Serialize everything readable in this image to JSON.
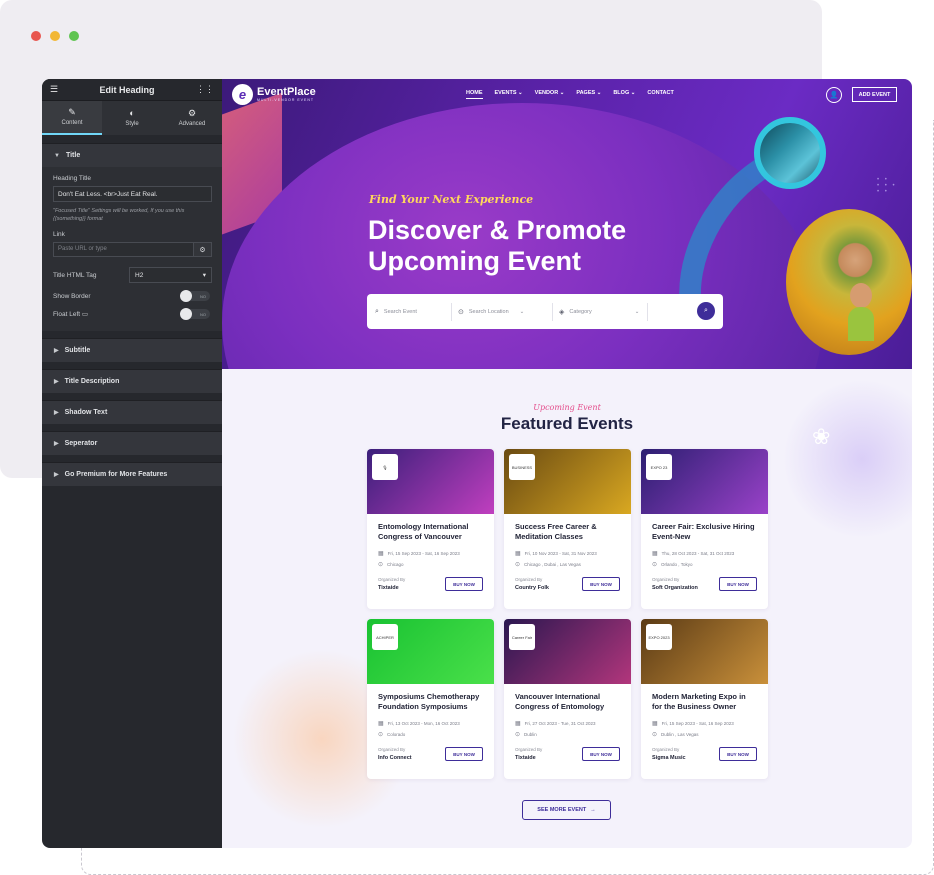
{
  "window": {
    "dots": [
      "#e8564f",
      "#f2b735",
      "#5fc451"
    ]
  },
  "editor": {
    "title": "Edit Heading",
    "menu_icon": "hamburger-icon",
    "grid_icon": "grid-icon",
    "tabs": [
      {
        "label": "Content",
        "icon": "pencil-icon"
      },
      {
        "label": "Style",
        "icon": "contrast-icon"
      },
      {
        "label": "Advanced",
        "icon": "gear-icon"
      }
    ],
    "title_section": {
      "label": "Title",
      "heading_title_label": "Heading Title",
      "heading_title_value": "Don't Eat Less. <br>Just Eat Real.",
      "note": "\"Focused Title\" Settings will be worked, If you use this {{something}} format",
      "link_label": "Link",
      "link_placeholder": "Paste URL or type",
      "tag_label": "Title HTML Tag",
      "tag_value": "H2",
      "show_border_label": "Show Border",
      "show_border_state": "NO",
      "float_left_label": "Float Left",
      "float_left_state": "NO"
    },
    "sections": [
      "Subtitle",
      "Title Description",
      "Shadow Text",
      "Seperator",
      "Go Premium for More Features"
    ]
  },
  "site": {
    "logo": {
      "name": "EventPlace",
      "tagline": "MULTI-VENDOR EVENT",
      "mark": "e"
    },
    "nav": [
      "HOME",
      "EVENTS",
      "VENDOR",
      "PAGES",
      "BLOG",
      "CONTACT"
    ],
    "add_event": "ADD EVENT",
    "hero": {
      "tagline": "Find Your Next Experience",
      "headline": "Discover & Promote Upcoming Event"
    },
    "search": {
      "event_placeholder": "Search Event",
      "location_placeholder": "Search Location",
      "category_placeholder": "Category"
    },
    "featured": {
      "subtitle": "Upcoming Event",
      "title": "Featured Events",
      "organized_label": "Organized By",
      "buy_label": "BUY NOW",
      "events": [
        {
          "title": "Entomology International Congress of Vancouver",
          "date": "Fri, 15 Sep 2023 - Sat, 16 Sep 2023",
          "location": "Chicago",
          "organizer": "Tixtaide",
          "badge": "",
          "img_from": "#3a1f7a",
          "img_to": "#c03fbf"
        },
        {
          "title": "Success Free Career & Meditation Classes",
          "date": "Fri, 10 Nov 2023 - Sat, 31 Nov 2023",
          "location": "Chicago , Dubai , Las Vegas",
          "organizer": "Country Folk",
          "badge": "BUSINESS",
          "img_from": "#6a4a12",
          "img_to": "#d9a821"
        },
        {
          "title": "Career Fair: Exclusive Hiring Event-New",
          "date": "Thu, 28 Oct 2023 - Sat, 31 Oct 2023",
          "location": "Orlando , Tokyo",
          "organizer": "Soft Organization",
          "badge": "EXPO 23",
          "img_from": "#2b1e70",
          "img_to": "#9a42c9"
        },
        {
          "title": "Symposiums Chemotherapy Foundation Symposiums",
          "date": "Fri, 13 Oct 2023 - Mon, 16 Oct 2023",
          "location": "Colorado",
          "organizer": "Info Connect",
          "badge": "ACHIPER",
          "img_from": "#19c232",
          "img_to": "#4ae04a"
        },
        {
          "title": "Vancouver International Congress of Entomology",
          "date": "Fri, 27 Oct 2023 - Tue, 31 Oct 2023",
          "location": "Dublin",
          "organizer": "Tixtaide",
          "badge": "Career Fair",
          "img_from": "#2a1750",
          "img_to": "#b2367c"
        },
        {
          "title": "Modern Marketing Expo in for the Business Owner",
          "date": "Fri, 15 Sep 2023 - Sat, 16 Sep 2023",
          "location": "Dublin , Las Vegas",
          "organizer": "Sigma Music",
          "badge": "EXPO 2023",
          "img_from": "#5a3a15",
          "img_to": "#c9903a"
        }
      ]
    },
    "see_more": "SEE MORE EVENT"
  }
}
